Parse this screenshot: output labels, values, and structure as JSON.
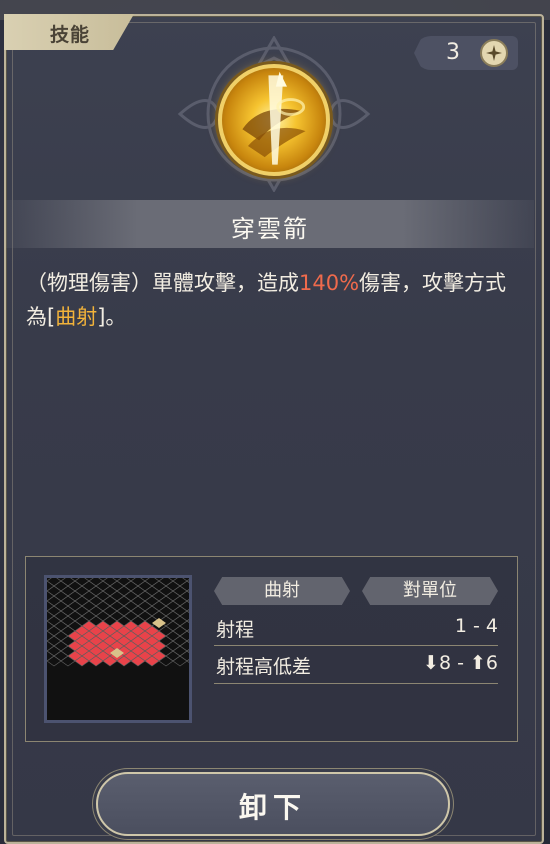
{
  "tab": {
    "label": "技能"
  },
  "cost": {
    "value": "3",
    "icon": "star-token-icon"
  },
  "skill": {
    "icon": "golden-arrow-skill-icon",
    "name": "穿雲箭",
    "desc_pre": "（物理傷害）單體攻擊，造成",
    "desc_percent": "140%",
    "desc_mid": "傷害，攻擊方式為[",
    "desc_mode": "曲射",
    "desc_post": "]。"
  },
  "info": {
    "tag_attack_type": "曲射",
    "tag_target": "對單位",
    "range_label": "射程",
    "range_value": "1 - 4",
    "height_label": "射程高低差",
    "height_value": "⬇8 - ⬆6"
  },
  "actions": {
    "unequip_label": "卸下"
  },
  "colors": {
    "panel": "#383b4a",
    "accent_red": "#ef6a4c",
    "accent_gold": "#f2b33a",
    "range_tile": "#e8434a",
    "frame": "#bcb39a"
  }
}
